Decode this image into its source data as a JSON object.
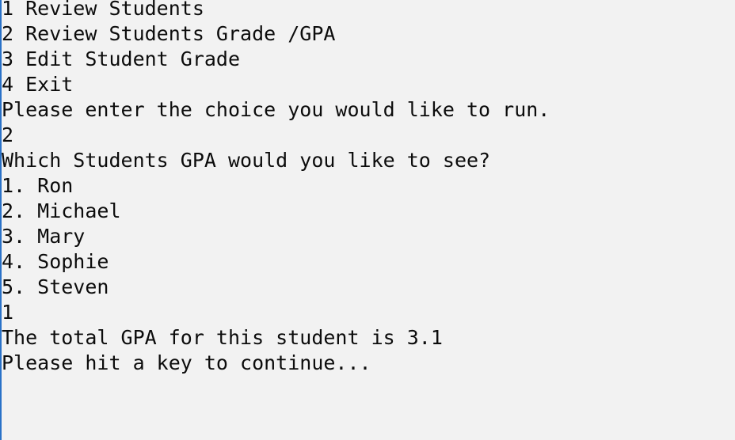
{
  "console": {
    "lines": [
      "1 Review Students",
      "2 Review Students Grade /GPA",
      "3 Edit Student Grade",
      "4 Exit",
      "Please enter the choice you would like to run.",
      "2",
      "Which Students GPA would you like to see?",
      "1. Ron",
      "2. Michael",
      "3. Mary",
      "4. Sophie",
      "5. Steven",
      "1",
      "The total GPA for this student is 3.1",
      "Please hit a key to continue..."
    ]
  }
}
